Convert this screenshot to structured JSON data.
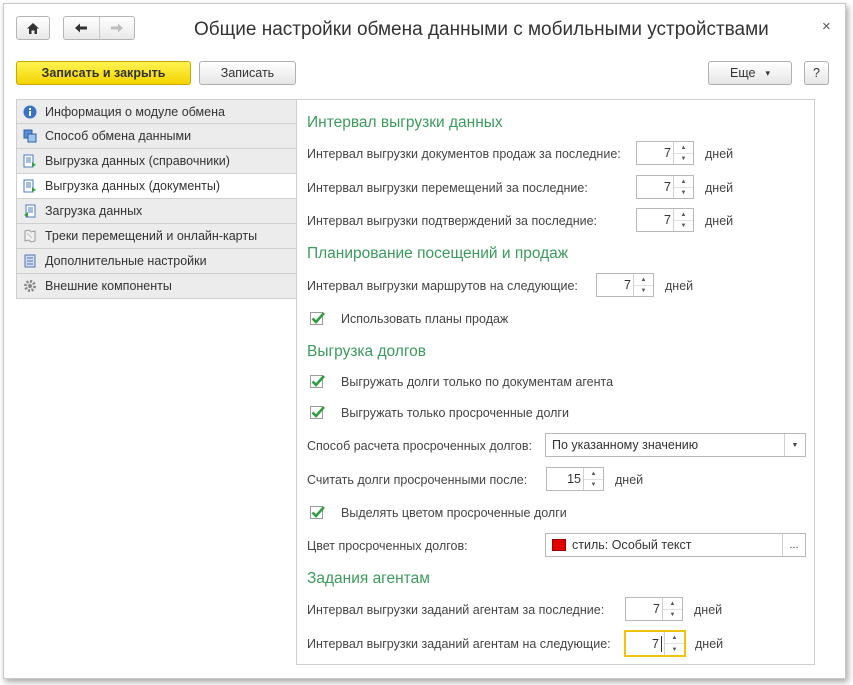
{
  "window": {
    "title": "Общие настройки обмена данными с мобильными устройствами",
    "close_glyph": "×"
  },
  "toolbar": {
    "save_close_label": "Записать и закрыть",
    "save_label": "Записать",
    "more_label": "Еще",
    "more_arrow": "▾",
    "help_label": "?"
  },
  "nav": {
    "items": [
      {
        "label": "Информация о модуле обмена",
        "icon": "info-icon"
      },
      {
        "label": "Способ обмена данными",
        "icon": "exchange-icon"
      },
      {
        "label": "Выгрузка данных (справочники)",
        "icon": "export-catalogs-icon"
      },
      {
        "label": "Выгрузка данных (документы)",
        "icon": "export-documents-icon"
      },
      {
        "label": "Загрузка данных",
        "icon": "import-icon"
      },
      {
        "label": "Треки перемещений и онлайн-карты",
        "icon": "map-icon"
      },
      {
        "label": "Дополнительные настройки",
        "icon": "list-icon"
      },
      {
        "label": "Внешние компоненты",
        "icon": "gear-icon"
      }
    ],
    "active_index": 3
  },
  "sections": {
    "interval": {
      "title": "Интервал выгрузки данных",
      "rows": [
        {
          "label": "Интервал выгрузки документов продаж за последние:",
          "value": "7",
          "unit": "дней"
        },
        {
          "label": "Интервал выгрузки перемещений за последние:",
          "value": "7",
          "unit": "дней"
        },
        {
          "label": "Интервал выгрузки подтверждений за последние:",
          "value": "7",
          "unit": "дней"
        }
      ]
    },
    "planning": {
      "title": "Планирование посещений и продаж",
      "routes_label": "Интервал выгрузки маршрутов на следующие:",
      "routes_value": "7",
      "routes_unit": "дней",
      "use_plans_label": "Использовать планы продаж"
    },
    "debts": {
      "title": "Выгрузка долгов",
      "only_agent_docs_label": "Выгружать долги только по документам агента",
      "only_overdue_label": "Выгружать только просроченные долги",
      "method_label": "Способ расчета просроченных долгов:",
      "method_value": "По указанному значению",
      "overdue_after_label": "Считать долги просроченными после:",
      "overdue_after_value": "15",
      "overdue_after_unit": "дней",
      "highlight_label": "Выделять цветом просроченные долги",
      "color_label": "Цвет просроченных долгов:",
      "color_value": "стиль: Особый текст",
      "color_swatch": "#e00000",
      "color_button": "..."
    },
    "tasks": {
      "title": "Задания агентам",
      "last_label": "Интервал выгрузки заданий агентам за последние:",
      "last_value": "7",
      "last_unit": "дней",
      "next_label": "Интервал выгрузки заданий агентам на следующие:",
      "next_value": "7",
      "next_unit": "дней"
    }
  },
  "colors": {
    "accent_green": "#3a9b5c",
    "primary_button": "#f3d400",
    "focus_border": "#f0c40a"
  }
}
